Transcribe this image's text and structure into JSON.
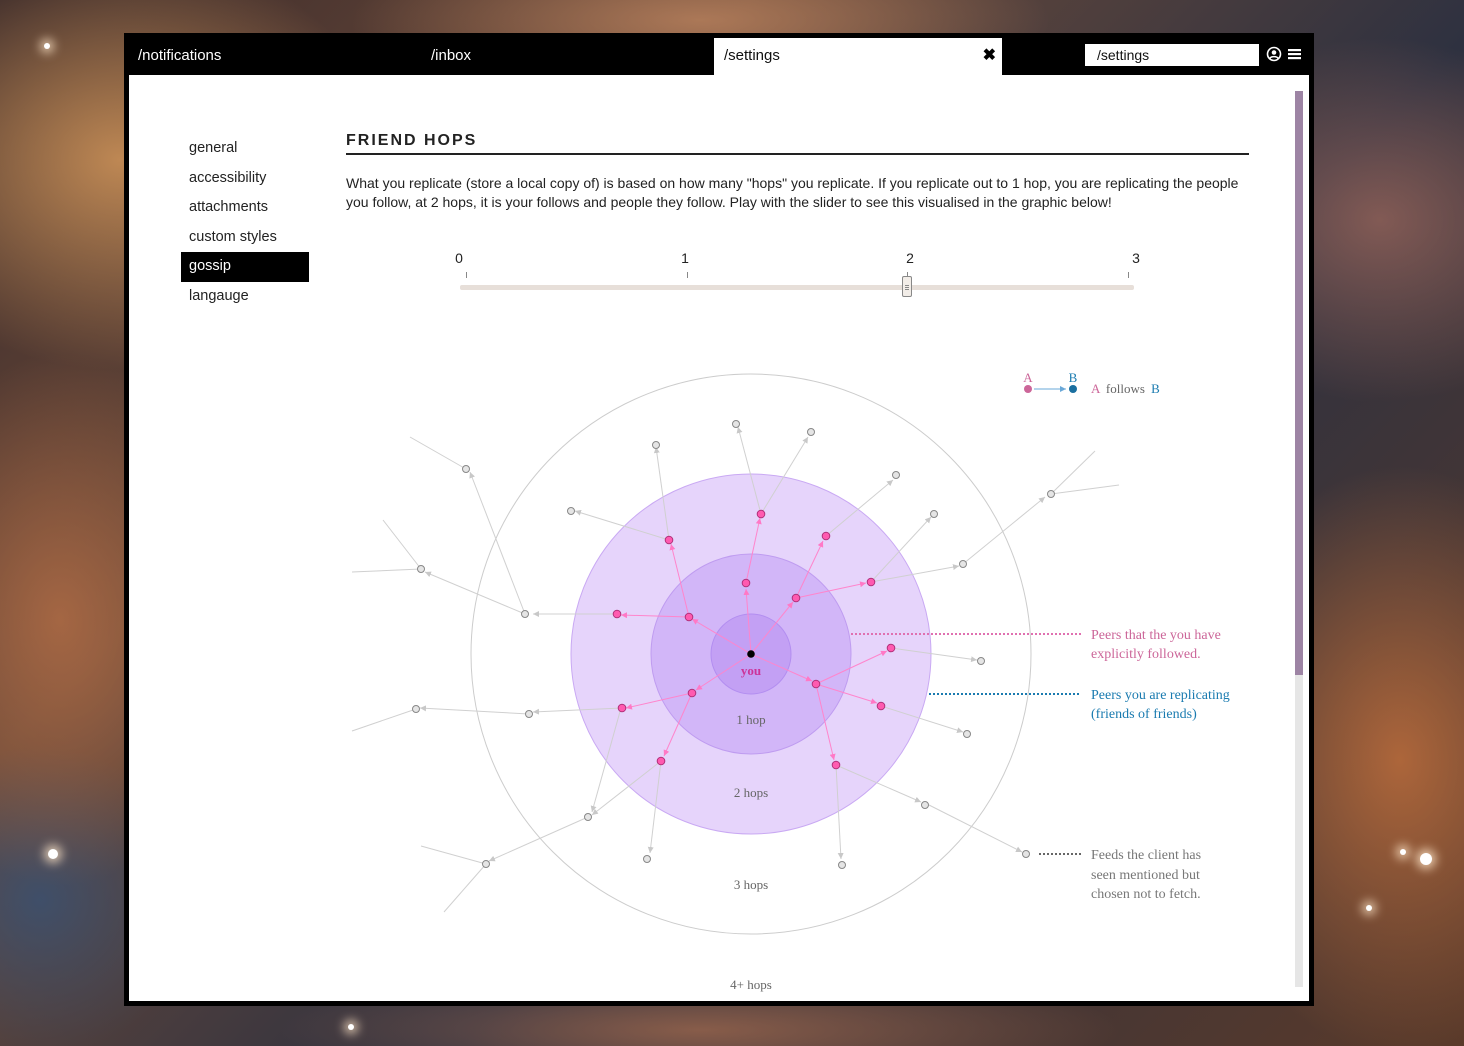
{
  "tabs": [
    {
      "label": "/notifications"
    },
    {
      "label": "/inbox"
    },
    {
      "label": "/settings",
      "close": "✖"
    }
  ],
  "url_bar": {
    "value": "/settings"
  },
  "sidebar": {
    "items": [
      {
        "label": "general"
      },
      {
        "label": "accessibility"
      },
      {
        "label": "attachments"
      },
      {
        "label": "custom styles"
      },
      {
        "label": "gossip",
        "active": true
      },
      {
        "label": "langauge"
      }
    ]
  },
  "section": {
    "title": "FRIEND HOPS",
    "description": "What you replicate (store a local copy of) is based on how many \"hops\" you replicate. If you replicate out to 1 hop, you are replicating the people you follow, at 2 hops, it is your follows and people they follow. Play with the slider to see this visualised in the graphic below!"
  },
  "slider": {
    "ticks": [
      "0",
      "1",
      "2",
      "3"
    ],
    "value": 2
  },
  "diagram": {
    "center_label": "you",
    "ring_labels": [
      "1 hop",
      "2 hops",
      "3 hops",
      "4+ hops"
    ],
    "legend": {
      "a": "A",
      "b": "B",
      "follows": "follows",
      "a_word": "A",
      "b_word": "B"
    },
    "annotations": {
      "followed": [
        "Peers that the you have",
        "explicitly followed."
      ],
      "replicating": [
        "Peers you are replicating",
        "(friends of friends)"
      ],
      "unfetched": [
        "Feeds the client has",
        "seen mentioned but",
        "chosen not to fetch."
      ]
    },
    "colors": {
      "followed": "#ff66cc",
      "followed_text": "#cc6699",
      "replicating_text": "#1a7bb0",
      "unfetched": "#888888",
      "inner_circle": "#c9a7f5",
      "outer_circle": "#e6d4fb"
    }
  }
}
